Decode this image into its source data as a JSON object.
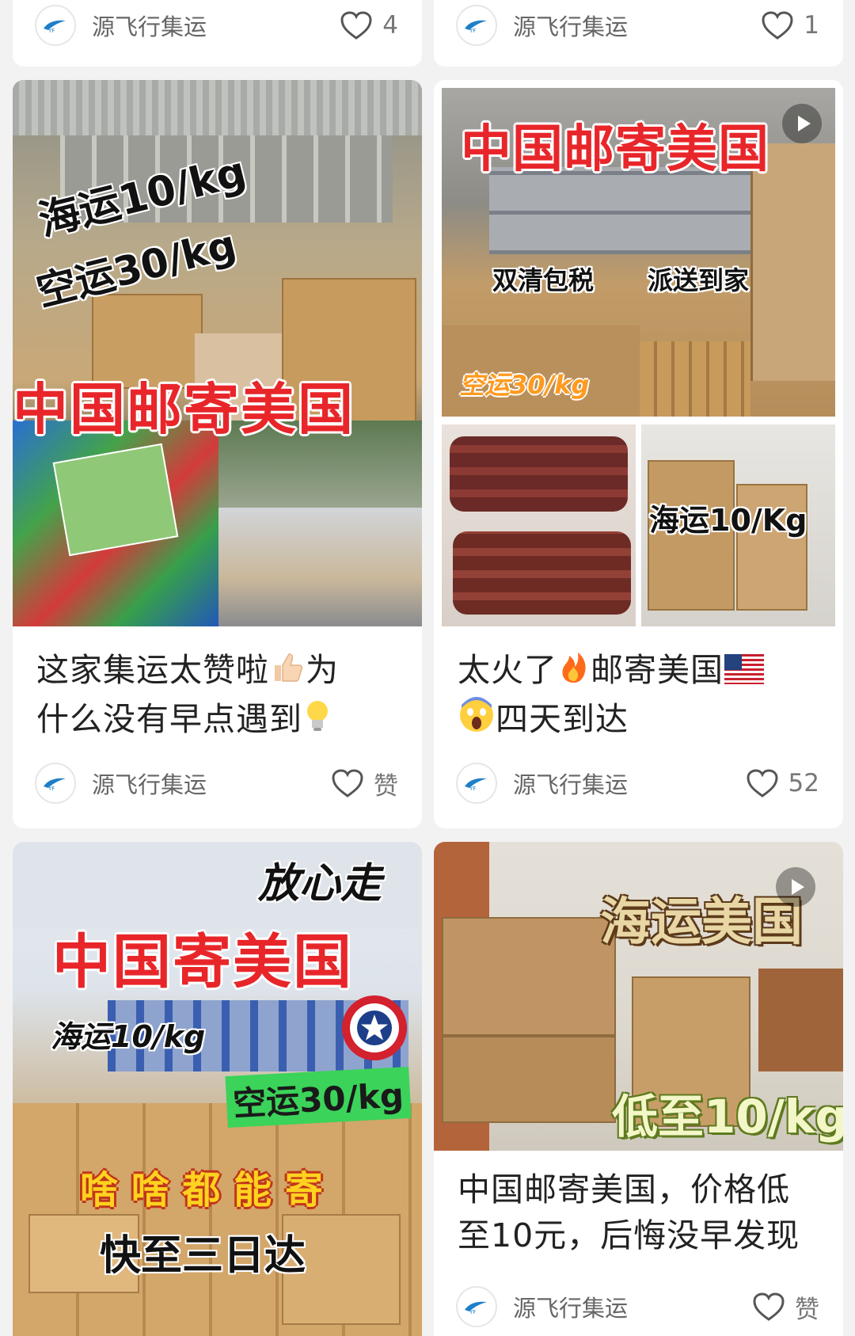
{
  "posts": [
    {
      "author": "源飞行集运",
      "likes": "4"
    },
    {
      "author": "源飞行集运",
      "likes": "1"
    },
    {
      "title_line1": "这家集运太赞啦",
      "title_line1_tail": "为",
      "title_line2": "什么没有早点遇到",
      "author": "源飞行集运",
      "likes": "赞",
      "overlays": {
        "sea": "海运10/kg",
        "air": "空运30/kg",
        "banner": "中国邮寄美国"
      }
    },
    {
      "title_line1_a": "太火了",
      "title_line1_b": "邮寄美国",
      "title_line2": "四天到达",
      "author": "源飞行集运",
      "likes": "52",
      "overlays": {
        "banner": "中国邮寄美国",
        "tax": "双清包税",
        "home": "派送到家",
        "air": "空运30/kg",
        "sea": "海运10/Kg"
      }
    },
    {
      "author": "源飞行集运",
      "overlays": {
        "go": "放心走",
        "banner": "中国寄美国",
        "sea": "海运10/kg",
        "air": "空运30/kg",
        "any": "啥 啥 都 能 寄",
        "fast": "快至三日达"
      }
    },
    {
      "title_line1": "中国邮寄美国，价格低",
      "title_line2": "至10元，后悔没早发现",
      "author": "源飞行集运",
      "likes": "赞",
      "overlays": {
        "banner": "海运美国",
        "low": "低至10/kg"
      }
    }
  ],
  "colors": {
    "accent_red": "#e8262a",
    "background": "#f2f2f2",
    "card": "#ffffff"
  },
  "icons": [
    "heart-outline-icon",
    "avatar-logo",
    "play-icon",
    "thumbs-up-emoji",
    "lightbulb-emoji",
    "fire-emoji",
    "us-flag-emoji",
    "scream-emoji",
    "shield-star-icon"
  ]
}
